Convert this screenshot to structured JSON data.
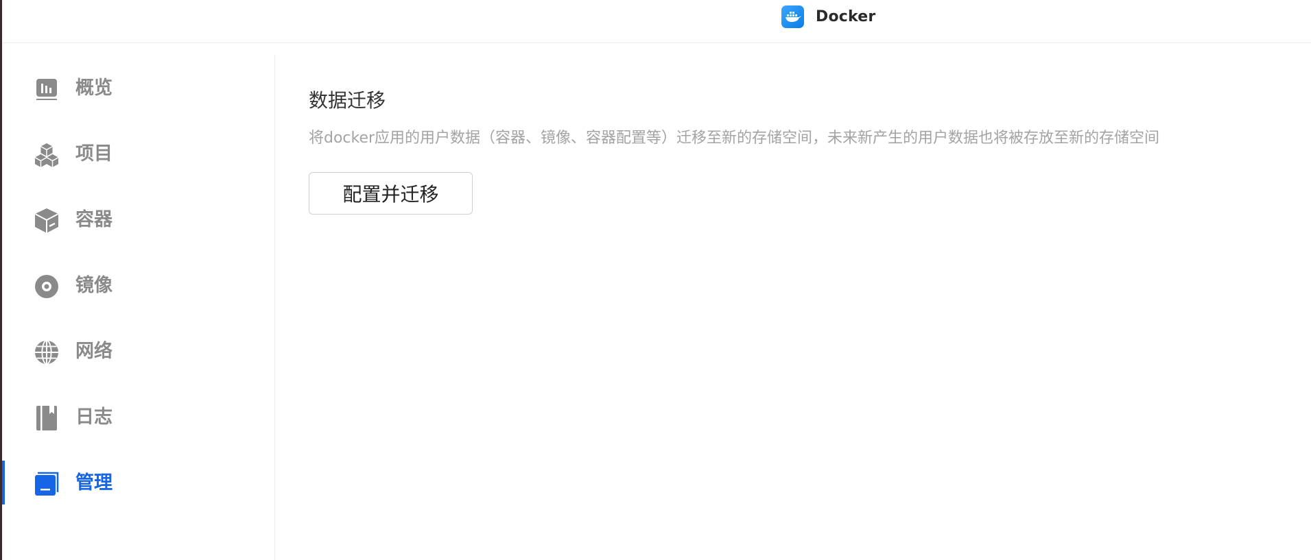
{
  "app": {
    "title": "Docker",
    "icon": "docker-whale-icon",
    "brand_color": "#1a8cff"
  },
  "sidebar": {
    "items": [
      {
        "label": "概览",
        "icon": "chart-overview-icon",
        "active": false
      },
      {
        "label": "项目",
        "icon": "cubes-project-icon",
        "active": false
      },
      {
        "label": "容器",
        "icon": "container-box-icon",
        "active": false
      },
      {
        "label": "镜像",
        "icon": "disc-image-icon",
        "active": false
      },
      {
        "label": "网络",
        "icon": "globe-network-icon",
        "active": false
      },
      {
        "label": "日志",
        "icon": "book-log-icon",
        "active": false
      },
      {
        "label": "管理",
        "icon": "manage-window-icon",
        "active": true
      }
    ],
    "active_color": "#1565e6",
    "inactive_color": "#8a8a8a"
  },
  "main": {
    "section_title": "数据迁移",
    "section_description": "将docker应用的用户数据（容器、镜像、容器配置等）迁移至新的存储空间，未来新产生的用户数据也将被存放至新的存储空间",
    "migrate_button_label": "配置并迁移"
  }
}
